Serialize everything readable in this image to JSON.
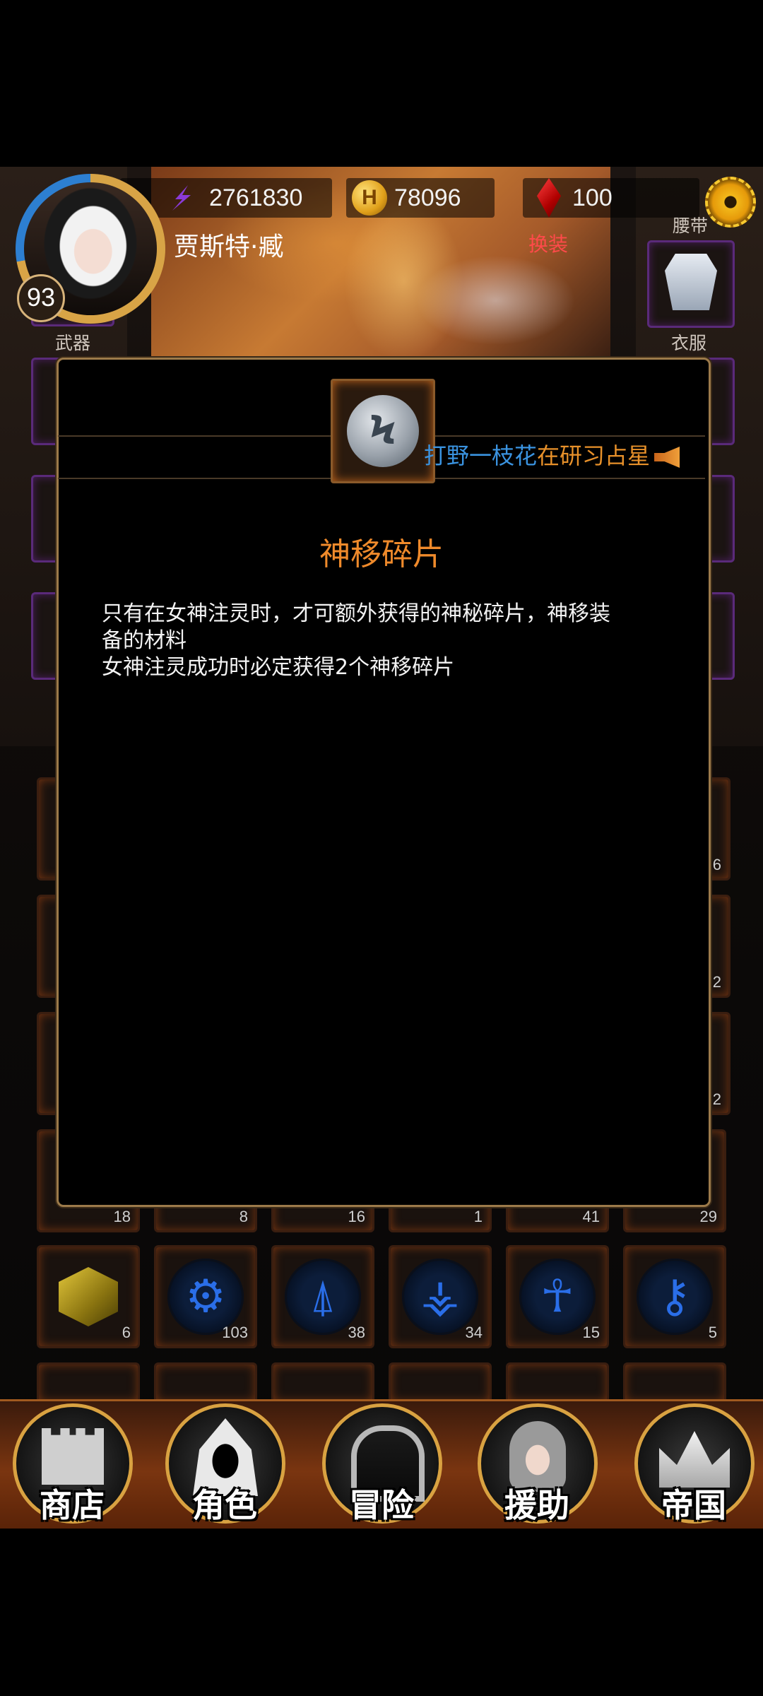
{
  "player": {
    "name": "贾斯特·臧",
    "level": "93",
    "power": "2761830",
    "gold": "78096",
    "gems": "100"
  },
  "header": {
    "outfit_label": "换装"
  },
  "equipment": {
    "left_label": "武器",
    "right_top_label": "腰带",
    "right_label": "衣服"
  },
  "announcement": {
    "player": "打野一枝花",
    "text": "在研习占星"
  },
  "item_popup": {
    "title": "神移碎片",
    "icon": "grey-stone-shard-icon",
    "description": [
      "只有在女神注灵时，才可额外获得的神秘碎片，神移装",
      "备的材料",
      "女神注灵成功时必定获得2个神移碎片"
    ]
  },
  "inventory": {
    "row_partial_counts": [
      "18",
      "8",
      "16",
      "1",
      "41",
      "29"
    ],
    "row_right_counts": [
      "6",
      "2",
      "2"
    ],
    "rune_row": [
      {
        "icon": "yellow-cube-icon",
        "count": "6"
      },
      {
        "icon": "rune-icon",
        "glyph": "⚙",
        "count": "103"
      },
      {
        "icon": "rune-icon",
        "glyph": "⍋",
        "count": "38"
      },
      {
        "icon": "rune-icon",
        "glyph": "⚶",
        "count": "34"
      },
      {
        "icon": "ankh-rune-icon",
        "glyph": "☥",
        "count": "15"
      },
      {
        "icon": "rune-icon",
        "glyph": "⚷",
        "count": "5"
      }
    ]
  },
  "bottom_nav": [
    {
      "label": "商店",
      "icon": "castle-icon"
    },
    {
      "label": "角色",
      "icon": "hooded-figure-icon"
    },
    {
      "label": "冒险",
      "icon": "gate-swords-icon"
    },
    {
      "label": "援助",
      "icon": "girl-portrait-icon"
    },
    {
      "label": "帝国",
      "icon": "crown-icon"
    }
  ],
  "colors": {
    "accent_orange": "#ef8a2b",
    "announcement_blue": "#3a93e0",
    "equipment_purple": "#5a2a7a"
  }
}
